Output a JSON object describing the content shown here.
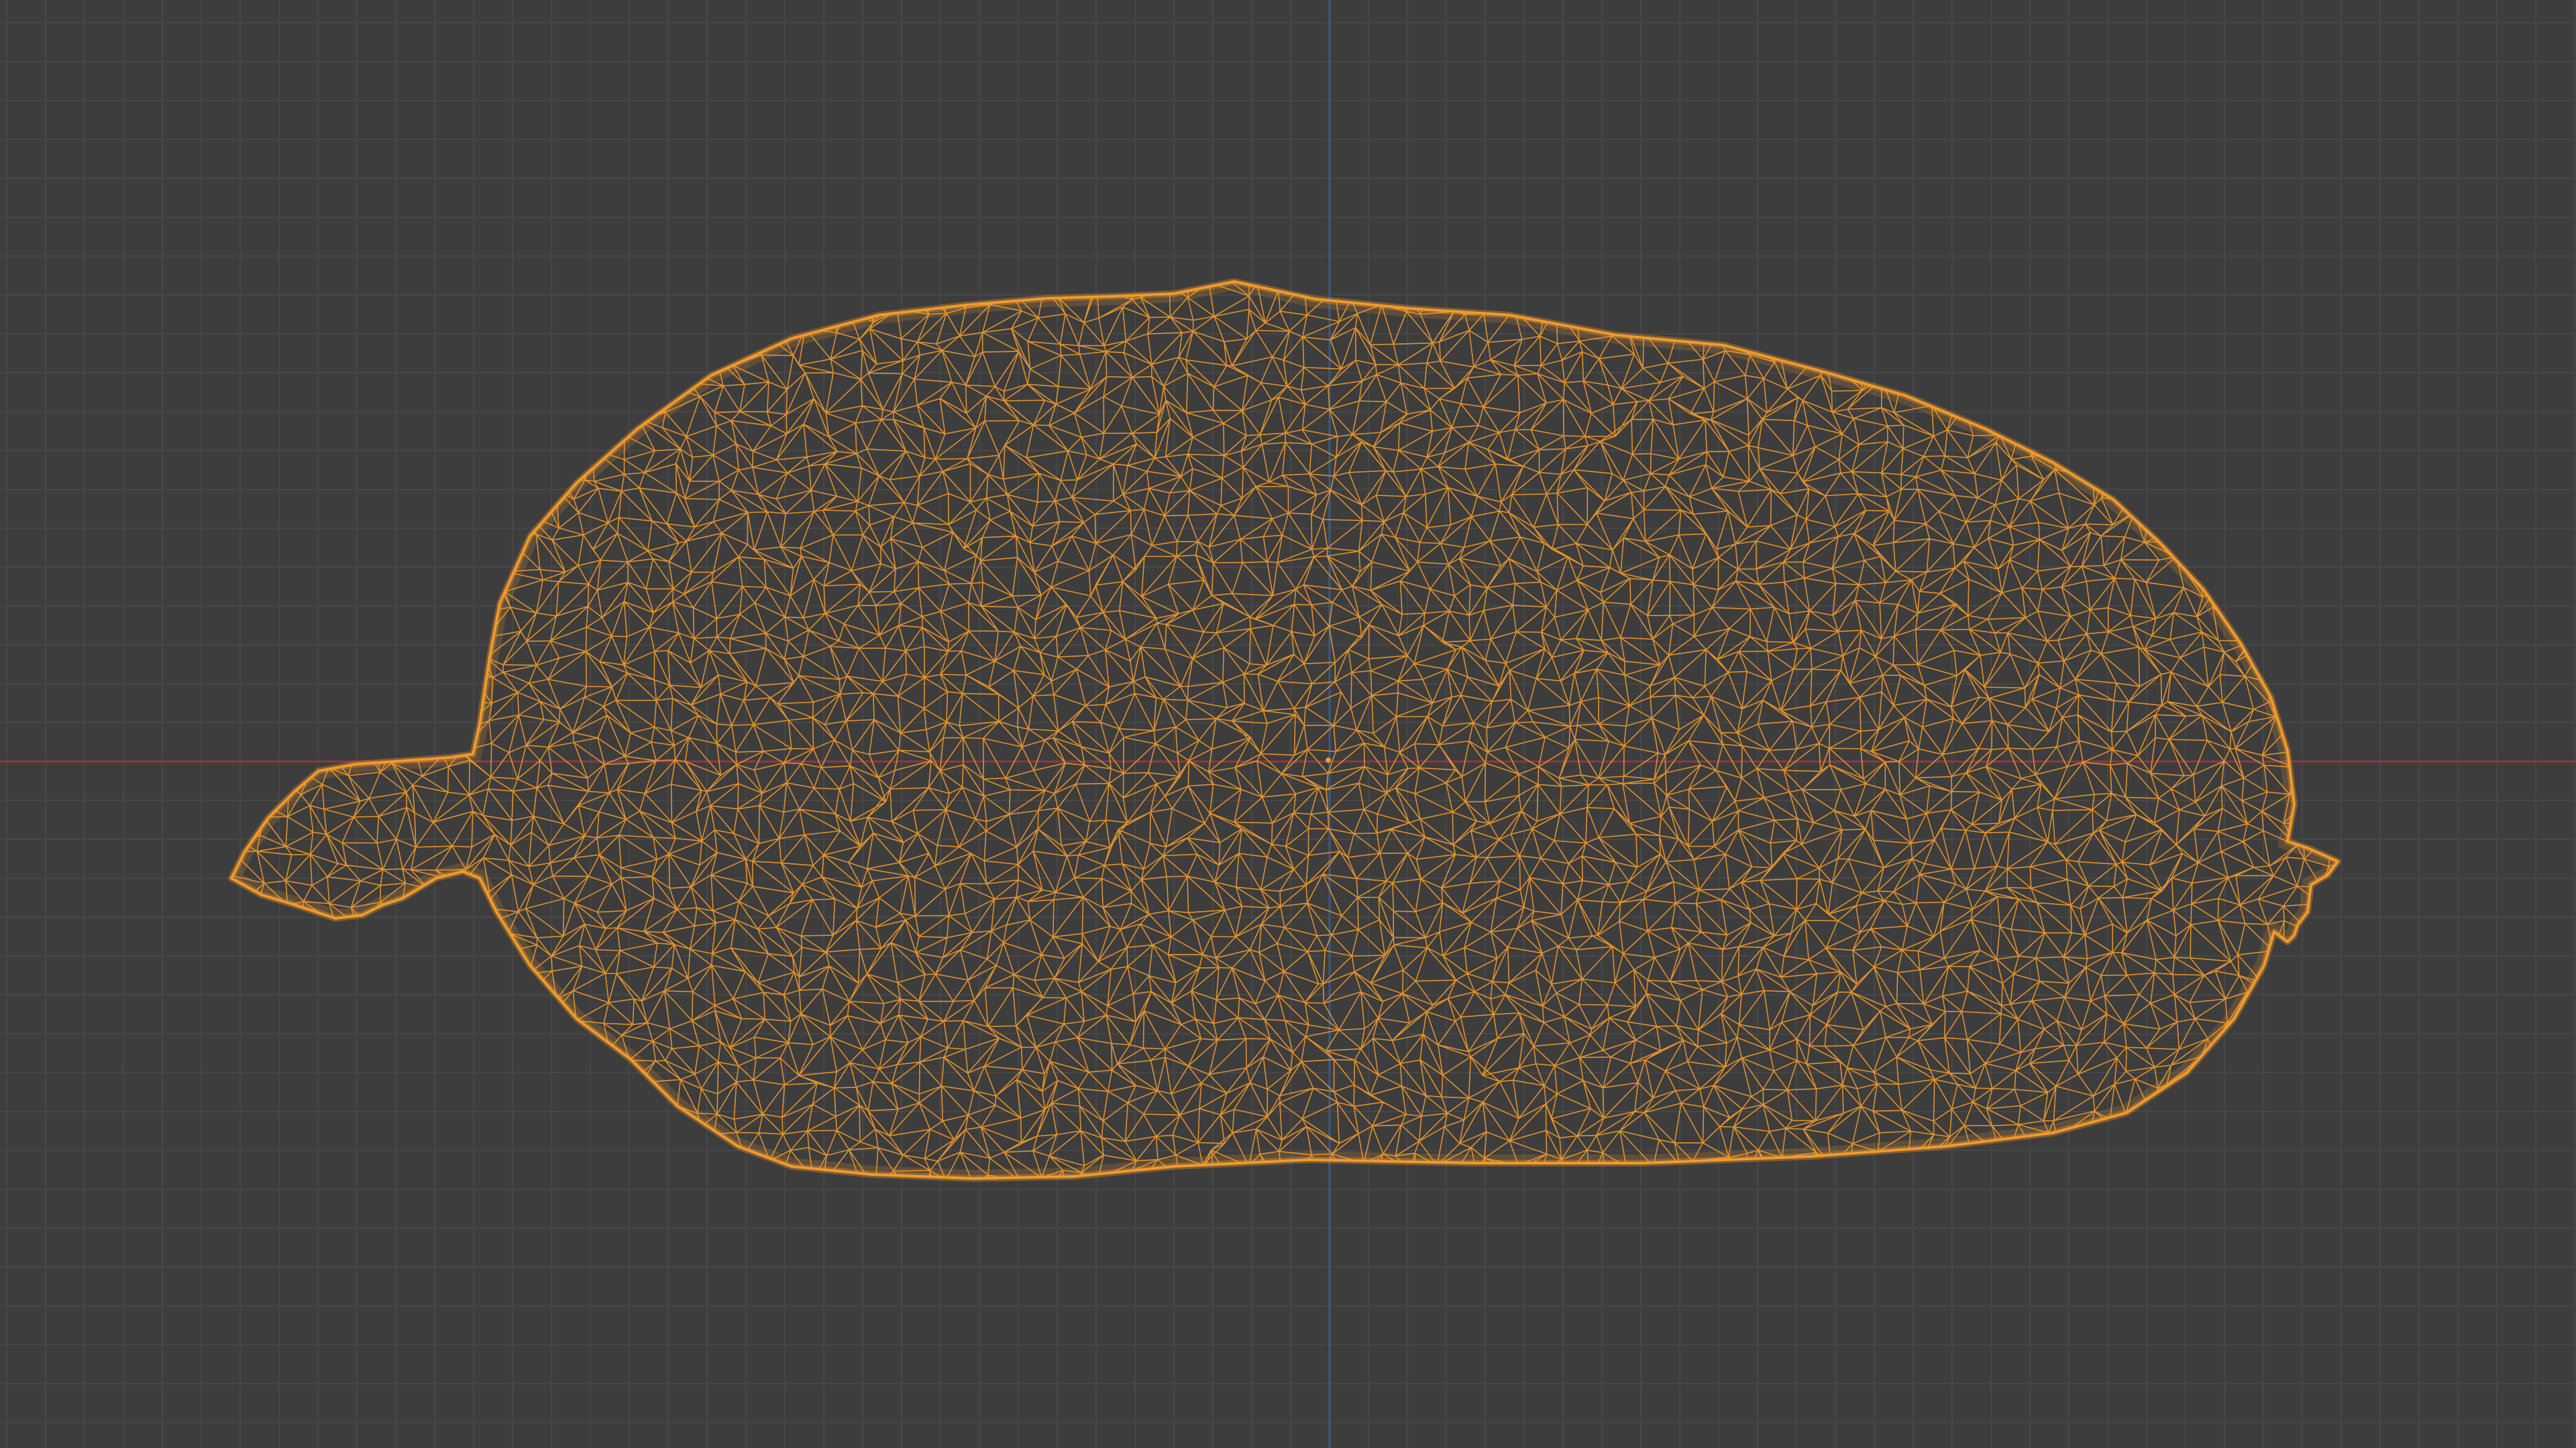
{
  "viewport": {
    "background_color": "#3d3d3d",
    "grid_minor_color": "#474747",
    "grid_major_color": "#4d4d4d",
    "x_axis_color": "#8a3a45",
    "y_axis_color": "#3c5a82",
    "grid_visible": true,
    "shading_mode": "wireframe"
  },
  "object": {
    "type": "mesh",
    "selected": true,
    "wire_color": "#f29a2c",
    "icon": "mesh-wireframe-icon"
  },
  "origin": {
    "icon": "object-origin-dot-icon"
  }
}
